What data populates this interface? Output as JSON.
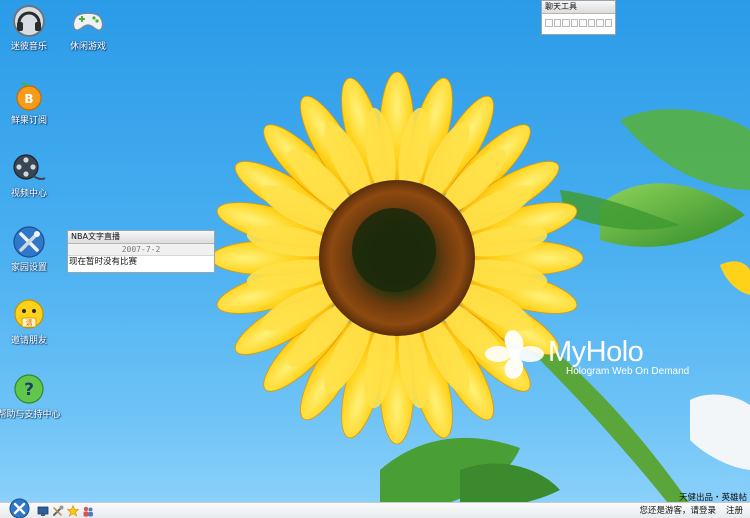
{
  "desktop": {
    "icons": [
      {
        "label": "迷彼音乐",
        "icon": "headphones-icon"
      },
      {
        "label": "休闲游戏",
        "icon": "gamepad-icon"
      },
      {
        "label": "鲜果订阅",
        "icon": "orange-feed-icon"
      },
      {
        "label": "视频中心",
        "icon": "film-reel-icon"
      },
      {
        "label": "家园设置",
        "icon": "settings-tools-icon"
      },
      {
        "label": "邀请朋友",
        "icon": "smiley-invite-icon"
      },
      {
        "label": "帮助与支持中心",
        "icon": "help-icon"
      }
    ]
  },
  "widgets": {
    "chat": {
      "title": "聊天工具"
    },
    "nba": {
      "title": "NBA文字直播",
      "date": "2007-7-2",
      "message": "现在暂时没有比赛"
    }
  },
  "brand": {
    "name": "MyHolo",
    "tagline": "Hologram Web On Demand"
  },
  "credit": "天健出品・英雄帖",
  "taskbar": {
    "status_text": "您还是游客，",
    "login_label": "请登录",
    "register_label": "注册"
  },
  "colors": {
    "sky_top": "#2b9be8",
    "sky_bottom": "#8fd3fb",
    "petal": "#ffd21a",
    "leaf": "#4caf3a",
    "taskbar": "#eef0f2"
  }
}
